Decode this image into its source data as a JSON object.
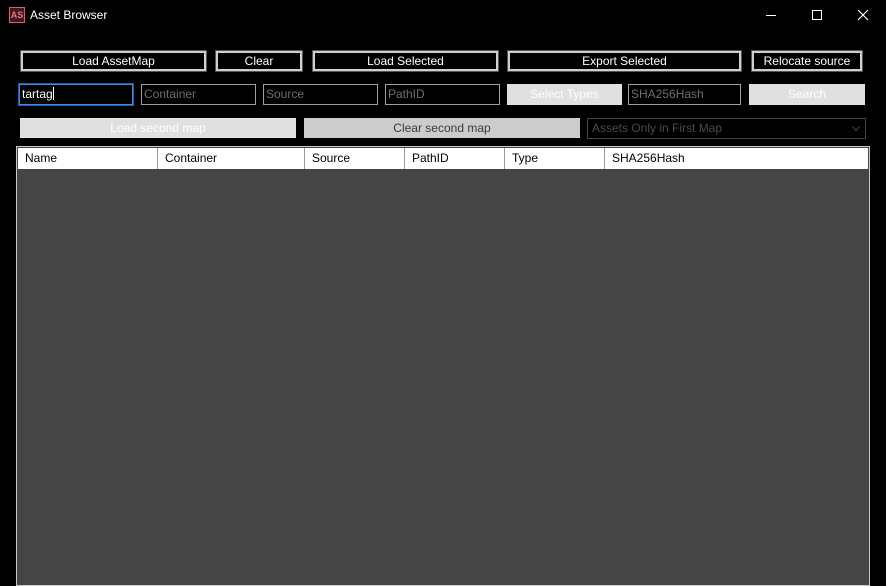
{
  "window": {
    "title": "Asset Browser",
    "icon_text": "AS",
    "controls": [
      "minimize-icon",
      "maximize-icon",
      "close-icon"
    ]
  },
  "toolbar": {
    "load_assetmap": "Load AssetMap",
    "clear": "Clear",
    "load_selected": "Load Selected",
    "export_selected": "Export Selected",
    "relocate_source": "Relocate source"
  },
  "filters": {
    "name_value": "tartag",
    "container_placeholder": "Container",
    "source_placeholder": "Source",
    "pathid_placeholder": "PathID",
    "select_types": "Select Types",
    "sha_placeholder": "SHA256Hash",
    "search": "Search"
  },
  "second_map": {
    "load": "Load second map",
    "clear": "Clear second map",
    "mode_selected": "Assets Only in First Map"
  },
  "table": {
    "columns": [
      "Name",
      "Container",
      "Source",
      "PathID",
      "Type",
      "SHA256Hash"
    ],
    "rows": []
  },
  "colors": {
    "background": "#000000",
    "grid_background": "#454545",
    "focus_border": "#3c8ce6",
    "icon_accent": "#e05a6a"
  }
}
